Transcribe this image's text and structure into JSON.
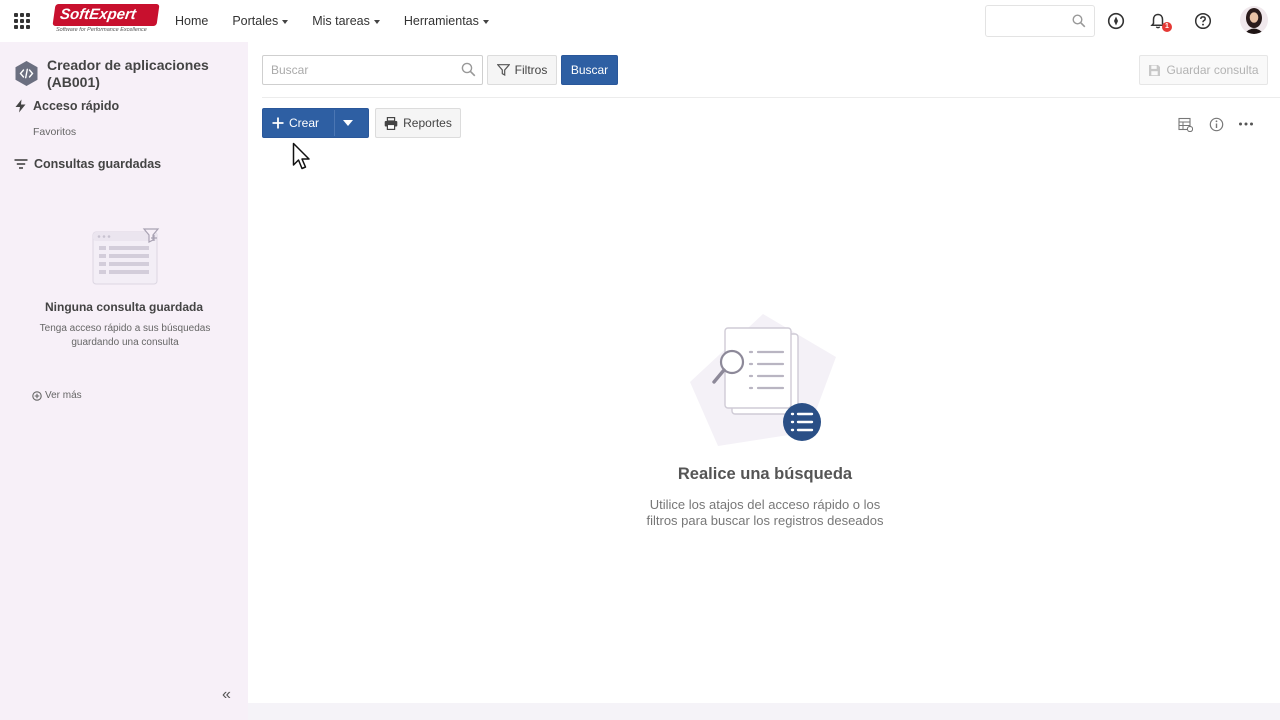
{
  "header": {
    "logo_text_1": "Soft",
    "logo_text_2": "Expert",
    "logo_tagline": "Software for Performance Excellence",
    "nav": [
      {
        "label": "Home",
        "has_menu": false
      },
      {
        "label": "Portales",
        "has_menu": true
      },
      {
        "label": "Mis tareas",
        "has_menu": true
      },
      {
        "label": "Herramientas",
        "has_menu": true
      }
    ],
    "notification_count": "1",
    "icons": [
      "apps-grid-icon",
      "search-icon",
      "compass-icon",
      "bell-icon",
      "help-icon",
      "avatar"
    ]
  },
  "sidebar": {
    "app_title": "Creador de aplicaciones (AB001)",
    "quick_access": "Acceso rápido",
    "favorites": "Favoritos",
    "saved_queries": "Consultas guardadas",
    "empty_title": "Ninguna consulta guardada",
    "empty_desc": "Tenga acceso rápido a sus búsquedas guardando una consulta",
    "see_more": "Ver más"
  },
  "toolbar": {
    "search_placeholder": "Buscar",
    "filters_label": "Filtros",
    "search_button": "Buscar",
    "save_query": "Guardar consulta",
    "create_label": "Crear",
    "reports_label": "Reportes"
  },
  "main": {
    "empty_title": "Realice una búsqueda",
    "empty_desc_1": "Utilice los atajos del acceso rápido o los",
    "empty_desc_2": "filtros para buscar los registros deseados"
  },
  "colors": {
    "primary": "#2e5fa3",
    "sidebar_bg": "#f7f0f8",
    "badge": "#e53935",
    "brand": "#c8102e"
  }
}
